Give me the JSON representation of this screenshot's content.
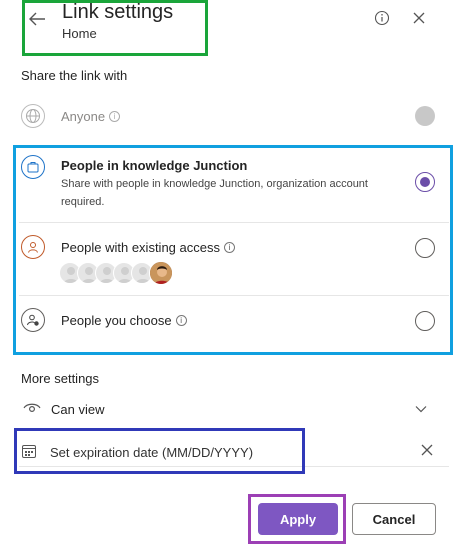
{
  "header": {
    "title": "Link settings",
    "subtitle": "Home"
  },
  "share": {
    "label": "Share the link with",
    "options": [
      {
        "title": "Anyone",
        "state": "disabled"
      },
      {
        "title": "People in knowledge Junction",
        "description": "Share with people in knowledge Junction, organization account required.",
        "state": "selected"
      },
      {
        "title": "People with existing access",
        "state": "unselected"
      },
      {
        "title": "People you choose",
        "state": "unselected"
      }
    ]
  },
  "more": {
    "label": "More settings",
    "permission": "Can view",
    "expiration_placeholder": "Set expiration date (MM/DD/YYYY)"
  },
  "buttons": {
    "apply": "Apply",
    "cancel": "Cancel"
  },
  "colors": {
    "accent": "#7e57c2",
    "highlight_green": "#1aa53a",
    "highlight_blue": "#10a0e0",
    "highlight_navy": "#3039b8",
    "highlight_purple": "#9c3fb5"
  }
}
